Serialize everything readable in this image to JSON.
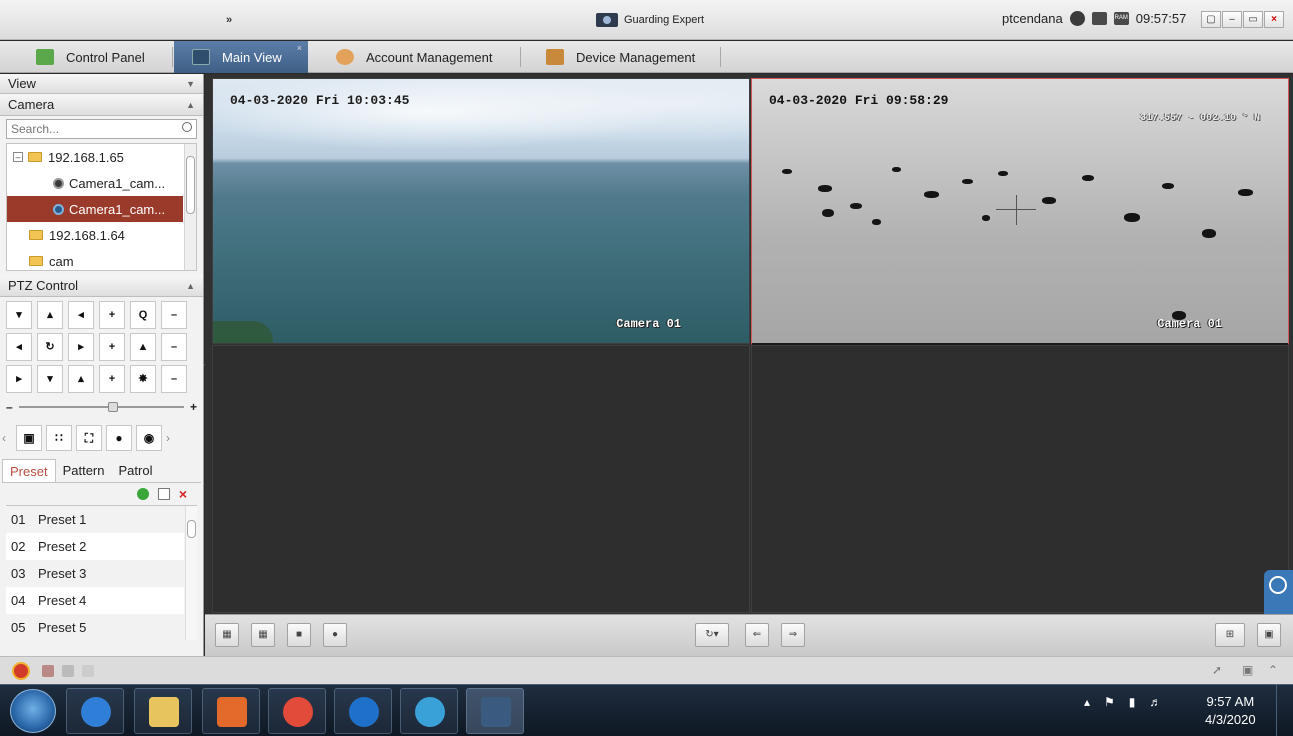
{
  "titlebar": {
    "app_name": "Guarding Expert",
    "user": "ptcendana",
    "clock": "09:57:57",
    "ram_label": "RAM"
  },
  "tabs": [
    {
      "label": "Control Panel",
      "icon": "control-panel-icon",
      "active": false
    },
    {
      "label": "Main View",
      "icon": "main-view-icon",
      "active": true
    },
    {
      "label": "Account Management",
      "icon": "account-icon",
      "active": false
    },
    {
      "label": "Device Management",
      "icon": "device-icon",
      "active": false
    }
  ],
  "left_panel": {
    "view_label": "View",
    "camera_label": "Camera",
    "search_placeholder": "Search...",
    "tree": [
      {
        "label": "192.168.1.65",
        "type": "folder",
        "expanded": true
      },
      {
        "label": "Camera1_cam...",
        "type": "camera",
        "selected": false
      },
      {
        "label": "Camera1_cam...",
        "type": "camera",
        "selected": true
      },
      {
        "label": "192.168.1.64",
        "type": "folder"
      },
      {
        "label": "cam",
        "type": "folder"
      }
    ],
    "ptz_label": "PTZ Control",
    "ptz_tabs": [
      "Preset",
      "Pattern",
      "Patrol"
    ],
    "ptz_active_tab": "Preset",
    "presets": [
      {
        "num": "01",
        "name": "Preset 1"
      },
      {
        "num": "02",
        "name": "Preset 2"
      },
      {
        "num": "03",
        "name": "Preset 3"
      },
      {
        "num": "04",
        "name": "Preset 4"
      },
      {
        "num": "05",
        "name": "Preset 5"
      }
    ]
  },
  "views": {
    "cam1": {
      "timestamp": "04-03-2020 Fri 10:03:45",
      "name": "Camera 01"
    },
    "cam2": {
      "timestamp": "04-03-2020 Fri 09:58:29",
      "name": "Camera 01",
      "coords": "317.557 - 002.10 ° N"
    }
  },
  "taskbar": {
    "time": "9:57 AM",
    "date": "4/3/2020"
  },
  "colors": {
    "active_tab": "#3f5f86",
    "selected_row": "#9a3a2a",
    "active_ptz_tab_text": "#b94f3f"
  }
}
